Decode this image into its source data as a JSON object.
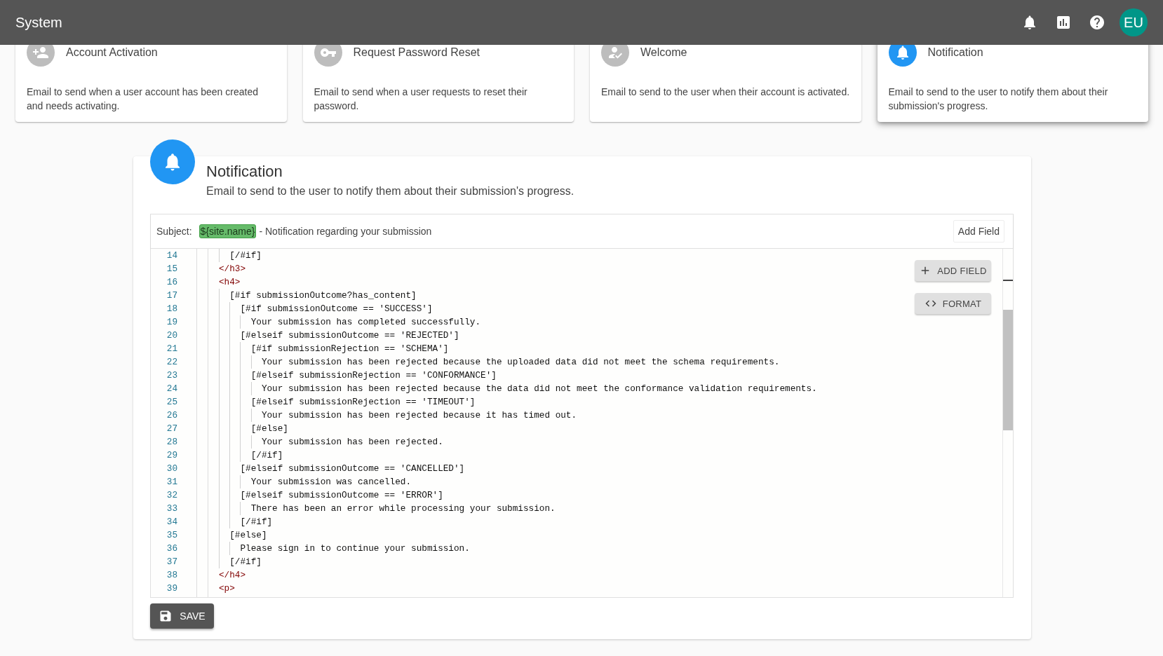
{
  "app_bar": {
    "title": "System",
    "avatar": "EU"
  },
  "template_cards": [
    {
      "title": "Account Activation",
      "description": "Email to send when a user account has been created and needs activating.",
      "selected": false
    },
    {
      "title": "Request Password Reset",
      "description": "Email to send when a user requests to reset their password.",
      "selected": false
    },
    {
      "title": "Welcome",
      "description": "Email to send to the user when their account is activated.",
      "selected": false
    },
    {
      "title": "Notification",
      "description": "Email to send to the user to notify them about their submission's progress.",
      "selected": true
    }
  ],
  "editor": {
    "title": "Notification",
    "description": "Email to send to the user to notify them about their submission's progress.",
    "subject_label": "Subject:",
    "subject_field": "${site.name}",
    "subject_text": "- Notification regarding your submission",
    "add_field_link": "Add Field",
    "code_lines": [
      {
        "number": "14",
        "kind": "text",
        "text": "  [/#if]"
      },
      {
        "number": "15",
        "kind": "tag",
        "text": "</h3>"
      },
      {
        "number": "16",
        "kind": "tag",
        "text": "<h4>"
      },
      {
        "number": "17",
        "kind": "text",
        "text": "  [#if submissionOutcome?has_content]"
      },
      {
        "number": "18",
        "kind": "text",
        "text": "    [#if submissionOutcome == 'SUCCESS']"
      },
      {
        "number": "19",
        "kind": "text",
        "text": "      Your submission has completed successfully."
      },
      {
        "number": "20",
        "kind": "text",
        "text": "    [#elseif submissionOutcome == 'REJECTED']"
      },
      {
        "number": "21",
        "kind": "text",
        "text": "      [#if submissionRejection == 'SCHEMA']"
      },
      {
        "number": "22",
        "kind": "text",
        "text": "        Your submission has been rejected because the uploaded data did not meet the schema requirements."
      },
      {
        "number": "23",
        "kind": "text",
        "text": "      [#elseif submissionRejection == 'CONFORMANCE']"
      },
      {
        "number": "24",
        "kind": "text",
        "text": "        Your submission has been rejected because the data did not meet the conformance validation requirements."
      },
      {
        "number": "25",
        "kind": "text",
        "text": "      [#elseif submissionRejection == 'TIMEOUT']"
      },
      {
        "number": "26",
        "kind": "text",
        "text": "        Your submission has been rejected because it has timed out."
      },
      {
        "number": "27",
        "kind": "text",
        "text": "      [#else]"
      },
      {
        "number": "28",
        "kind": "text",
        "text": "        Your submission has been rejected."
      },
      {
        "number": "29",
        "kind": "text",
        "text": "      [/#if]"
      },
      {
        "number": "30",
        "kind": "text",
        "text": "    [#elseif submissionOutcome == 'CANCELLED']"
      },
      {
        "number": "31",
        "kind": "text",
        "text": "      Your submission was cancelled."
      },
      {
        "number": "32",
        "kind": "text",
        "text": "    [#elseif submissionOutcome == 'ERROR']"
      },
      {
        "number": "33",
        "kind": "text",
        "text": "      There has been an error while processing your submission."
      },
      {
        "number": "34",
        "kind": "text",
        "text": "    [/#if]"
      },
      {
        "number": "35",
        "kind": "text",
        "text": "  [#else]"
      },
      {
        "number": "36",
        "kind": "text",
        "text": "    Please sign in to continue your submission."
      },
      {
        "number": "37",
        "kind": "text",
        "text": "  [/#if]"
      },
      {
        "number": "38",
        "kind": "tag",
        "text": "</h4>"
      },
      {
        "number": "39",
        "kind": "tag",
        "text": "<p>"
      }
    ],
    "buttons": [
      {
        "kind": "add",
        "label": "ADD FIELD"
      },
      {
        "kind": "format",
        "label": "FORMAT"
      }
    ],
    "save_button": "SAVE"
  }
}
